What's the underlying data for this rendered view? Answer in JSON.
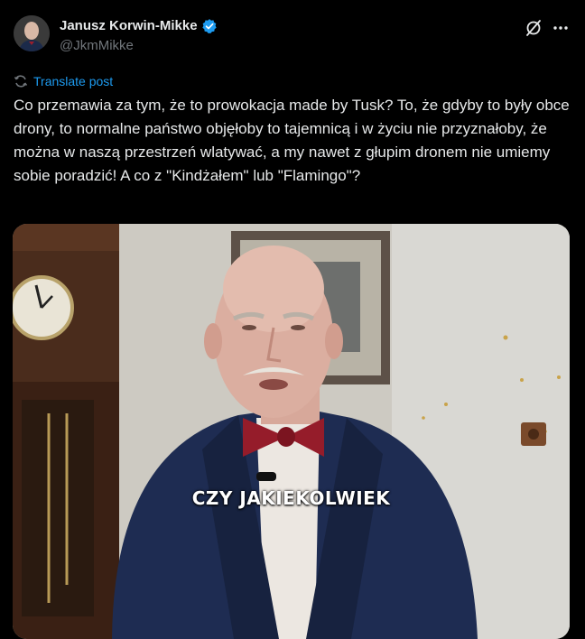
{
  "author": {
    "name": "Janusz Korwin-Mikke",
    "handle": "@JkmMikke",
    "verified": true
  },
  "actions": {
    "translate_label": "Translate post",
    "grok_icon": "grok-icon",
    "more_icon": "more-dots-icon"
  },
  "post": {
    "text": "Co przemawia za tym, że to prowokacja made by Tusk? To, że gdyby to były obce drony, to normalne państwo objęłoby to tajemnicą i w życiu nie przyznałoby, że można w naszą przestrzeń wlatywać, a my nawet z głupim dronem nie umiemy sobie poradzić! A co z \"Kindżałem\" lub \"Flamingo\"?"
  },
  "media": {
    "type": "video",
    "caption": "CZY JAKIEKOLWIEK"
  },
  "colors": {
    "background": "#000000",
    "text": "#e7e9ea",
    "secondary": "#71767b",
    "accent": "#1d9bf0"
  }
}
